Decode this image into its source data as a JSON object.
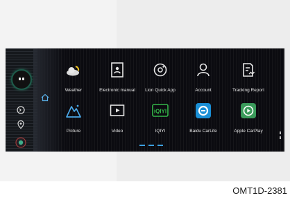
{
  "apps": [
    {
      "label": "Weather",
      "icon": "weather-icon"
    },
    {
      "label": "Electronic manual",
      "icon": "manual-icon"
    },
    {
      "label": "Lion Quick App",
      "icon": "lion-quick-app-icon"
    },
    {
      "label": "Account",
      "icon": "account-icon"
    },
    {
      "label": "Tracking Report",
      "icon": "tracking-report-icon"
    },
    {
      "label": "Picture",
      "icon": "picture-icon"
    },
    {
      "label": "Video",
      "icon": "video-icon"
    },
    {
      "label": "IQIYI",
      "icon": "iqiyi-icon"
    },
    {
      "label": "Baidu CarLife",
      "icon": "baidu-carlife-icon"
    },
    {
      "label": "Apple CarPlay",
      "icon": "apple-carplay-icon"
    }
  ],
  "iqiyi_logo_text": "iQIYI",
  "figure_code": "OMT1D-2381",
  "colors": {
    "accent": "#3ca0e0",
    "carlife": "#1a8fd6",
    "carplay": "#3a9a5a",
    "avatar_glow": "#2fbf8e"
  }
}
